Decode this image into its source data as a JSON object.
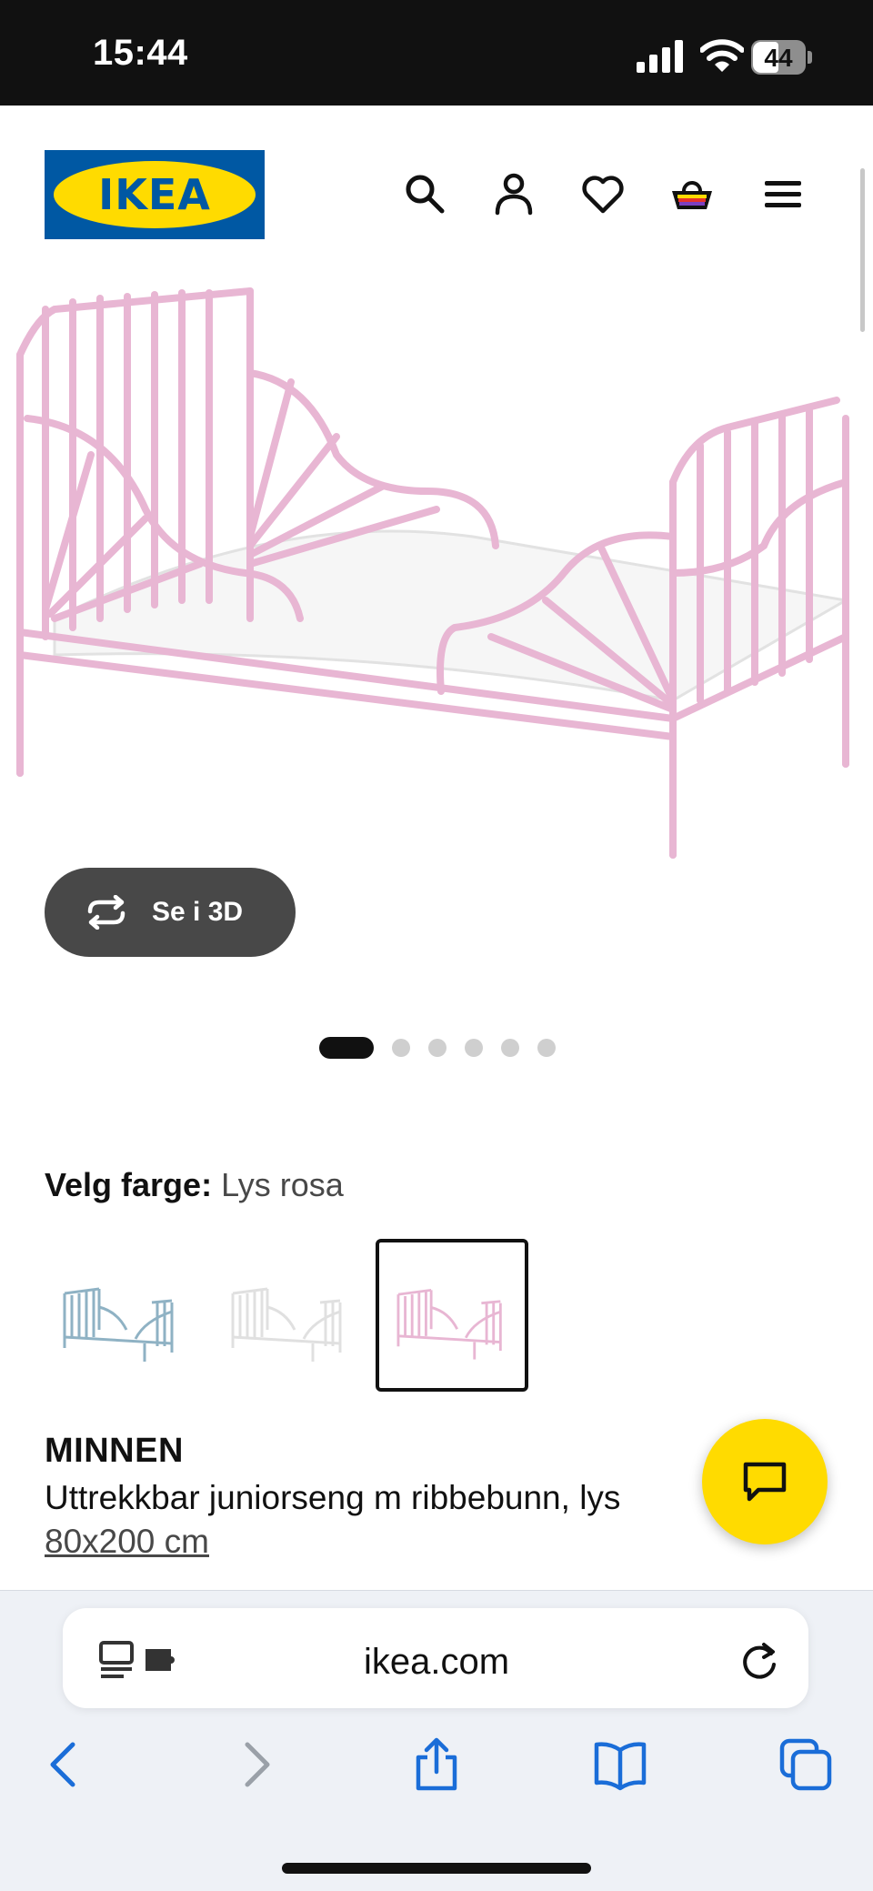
{
  "status_bar": {
    "time": "15:44",
    "battery": "44"
  },
  "header": {
    "logo_text": "IKEA",
    "icons": [
      "search-icon",
      "account-icon",
      "heart-icon",
      "cart-icon",
      "menu-icon"
    ]
  },
  "gallery": {
    "view_3d_label": "Se i 3D",
    "image_count": 6,
    "active_index": 0
  },
  "color": {
    "label": "Velg farge:",
    "value": "Lys rosa",
    "swatches": [
      "blue",
      "white",
      "pink"
    ],
    "selected_index": 2,
    "colors": {
      "blue": "#8fb2c4",
      "white": "#e8e8e8",
      "pink": "#e8b6d3"
    }
  },
  "product": {
    "name": "MINNEN",
    "description": "Uttrekkbar juniorseng m ribbebunn, lys",
    "size": "80x200 cm"
  },
  "browser": {
    "url": "ikea.com"
  },
  "colors": {
    "ikea_blue": "#0058a3",
    "ikea_yellow": "#ffdb00",
    "bed_pink": "#e8b6d3",
    "safari_blue": "#1a6dd8"
  }
}
